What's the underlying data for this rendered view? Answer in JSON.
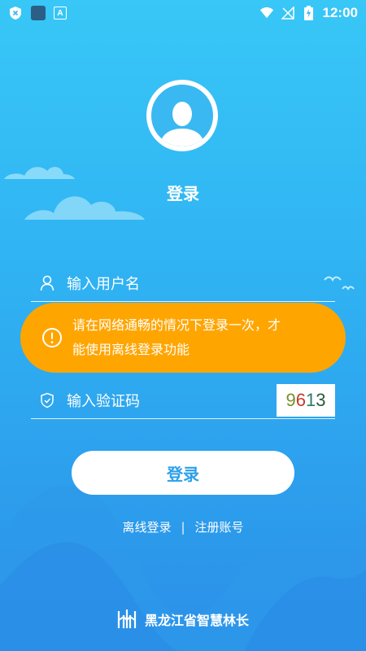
{
  "status_bar": {
    "time": "12:00",
    "icons": [
      "shield-x-icon",
      "app-square-icon",
      "a-badge-icon",
      "wifi-icon",
      "no-signal-icon",
      "battery-charging-icon"
    ]
  },
  "login": {
    "title": "登录",
    "username_placeholder": "输入用户名",
    "captcha_placeholder": "输入验证码",
    "captcha_code": [
      "9",
      "6",
      "1",
      "3"
    ],
    "button_label": "登录",
    "offline_login": "离线登录",
    "separator": "|",
    "register": "注册账号"
  },
  "toast": {
    "line1": "请在网络通畅的情况下登录一次，才",
    "line2": "能使用离线登录功能"
  },
  "footer": {
    "org_name": "黑龙江省智慧林长"
  },
  "colors": {
    "bg_top": "#38c7f7",
    "bg_bottom": "#2b8fe8",
    "toast": "#ffa500",
    "button_text": "#2aa0ea"
  }
}
